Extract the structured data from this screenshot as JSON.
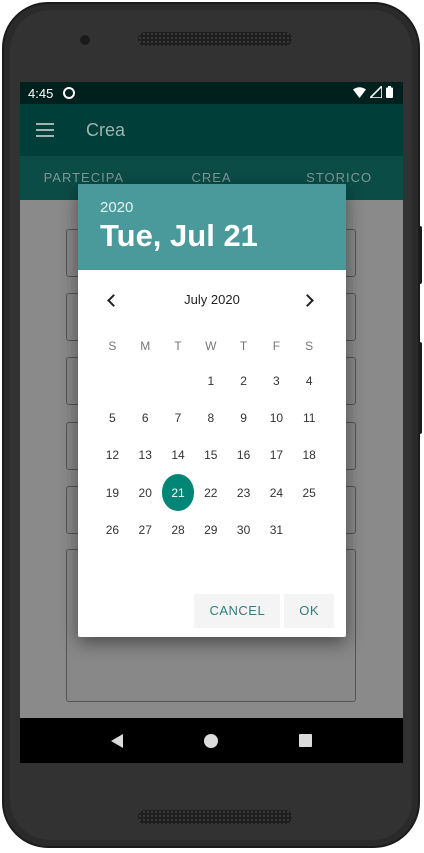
{
  "status_bar": {
    "time": "4:45"
  },
  "app_bar": {
    "title": "Crea"
  },
  "tabs": [
    {
      "label": "PARTECIPA"
    },
    {
      "label": "CREA"
    },
    {
      "label": "STORICO"
    }
  ],
  "date_picker": {
    "year": "2020",
    "selected_date": "Tue, Jul 21",
    "month_label": "July 2020",
    "weekdays": [
      "S",
      "M",
      "T",
      "W",
      "T",
      "F",
      "S"
    ],
    "weeks": [
      [
        "",
        "",
        "",
        "1",
        "2",
        "3",
        "4"
      ],
      [
        "5",
        "6",
        "7",
        "8",
        "9",
        "10",
        "11"
      ],
      [
        "12",
        "13",
        "14",
        "15",
        "16",
        "17",
        "18"
      ],
      [
        "19",
        "20",
        "21",
        "22",
        "23",
        "24",
        "25"
      ],
      [
        "26",
        "27",
        "28",
        "29",
        "30",
        "31",
        ""
      ]
    ],
    "selected_day": "21",
    "cancel_label": "CANCEL",
    "ok_label": "OK",
    "accent_color": "#008577",
    "header_color": "#4b9a9b"
  }
}
